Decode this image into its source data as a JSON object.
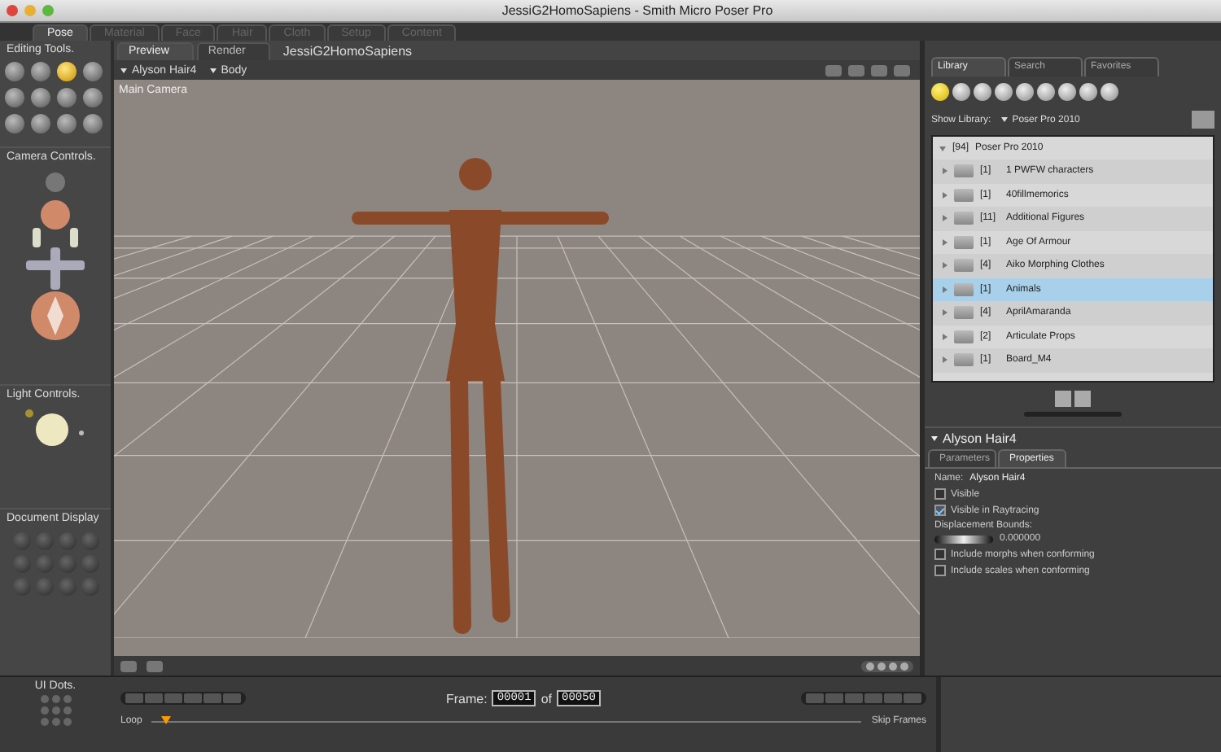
{
  "window": {
    "title": "JessiG2HomoSapiens - Smith Micro Poser Pro"
  },
  "rooms": [
    {
      "label": "Pose",
      "selected": true
    },
    {
      "label": "Material",
      "selected": false
    },
    {
      "label": "Face",
      "selected": false
    },
    {
      "label": "Hair",
      "selected": false
    },
    {
      "label": "Cloth",
      "selected": false
    },
    {
      "label": "Setup",
      "selected": false
    },
    {
      "label": "Content",
      "selected": false
    }
  ],
  "left_panel": {
    "editing_tools": {
      "title": "Editing Tools.",
      "tools": [
        {
          "selected": false
        },
        {
          "selected": false
        },
        {
          "selected": true
        },
        {
          "selected": false
        },
        {
          "selected": false
        },
        {
          "selected": false
        },
        {
          "selected": false
        },
        {
          "selected": false
        },
        {
          "selected": false
        },
        {
          "selected": false
        },
        {
          "selected": false
        },
        {
          "selected": false
        }
      ]
    },
    "camera_controls": {
      "title": "Camera Controls."
    },
    "light_controls": {
      "title": "Light Controls."
    },
    "document_display": {
      "title": "Document Display"
    }
  },
  "document": {
    "tabs": [
      {
        "label": "Preview",
        "selected": true
      },
      {
        "label": "Render",
        "selected": false
      }
    ],
    "title": "JessiG2HomoSapiens",
    "menus": [
      "Alyson Hair4",
      "Body"
    ],
    "camera": "Main Camera"
  },
  "library": {
    "tabs": [
      {
        "label": "Library",
        "selected": true
      },
      {
        "label": "Search",
        "selected": false
      },
      {
        "label": "Favorites",
        "selected": false
      }
    ],
    "categories": [
      {
        "selected": true
      },
      {
        "selected": false
      },
      {
        "selected": false
      },
      {
        "selected": false
      },
      {
        "selected": false
      },
      {
        "selected": false
      },
      {
        "selected": false
      },
      {
        "selected": false
      },
      {
        "selected": false
      }
    ],
    "show_label": "Show Library:",
    "show_value": "Poser Pro 2010",
    "root": {
      "count": "[94]",
      "name": "Poser Pro 2010",
      "expanded": true
    },
    "items": [
      {
        "count": "[1]",
        "name": "1 PWFW characters",
        "selected": false
      },
      {
        "count": "[1]",
        "name": "40fillmemorics",
        "selected": false
      },
      {
        "count": "[11]",
        "name": "Additional Figures",
        "selected": false
      },
      {
        "count": "[1]",
        "name": "Age Of Armour",
        "selected": false
      },
      {
        "count": "[4]",
        "name": "Aiko Morphing Clothes",
        "selected": false
      },
      {
        "count": "[1]",
        "name": "Animals",
        "selected": true
      },
      {
        "count": "[4]",
        "name": "AprilAmaranda",
        "selected": false
      },
      {
        "count": "[2]",
        "name": "Articulate Props",
        "selected": false
      },
      {
        "count": "[1]",
        "name": "Board_M4",
        "selected": false
      }
    ]
  },
  "properties": {
    "title": "Alyson Hair4",
    "tabs": [
      {
        "label": "Parameters",
        "selected": false
      },
      {
        "label": "Properties",
        "selected": true
      }
    ],
    "name_label": "Name:",
    "name_value": "Alyson Hair4",
    "options": [
      {
        "kind": "checkbox",
        "label": "Visible",
        "checked": false
      },
      {
        "kind": "checkbox",
        "label": "Visible in Raytracing",
        "checked": true
      },
      {
        "kind": "dial",
        "label": "Displacement Bounds:",
        "value": "0.000000"
      },
      {
        "kind": "checkbox",
        "label": "Include morphs when conforming",
        "checked": false
      },
      {
        "kind": "checkbox",
        "label": "Include scales when conforming",
        "checked": false
      }
    ]
  },
  "timeline": {
    "ui_dots": "UI Dots.",
    "frame_label": "Frame:",
    "frame": "00001",
    "of": "of",
    "total": "00050",
    "loop": "Loop",
    "skip_frames": "Skip Frames",
    "level": 0.02
  }
}
